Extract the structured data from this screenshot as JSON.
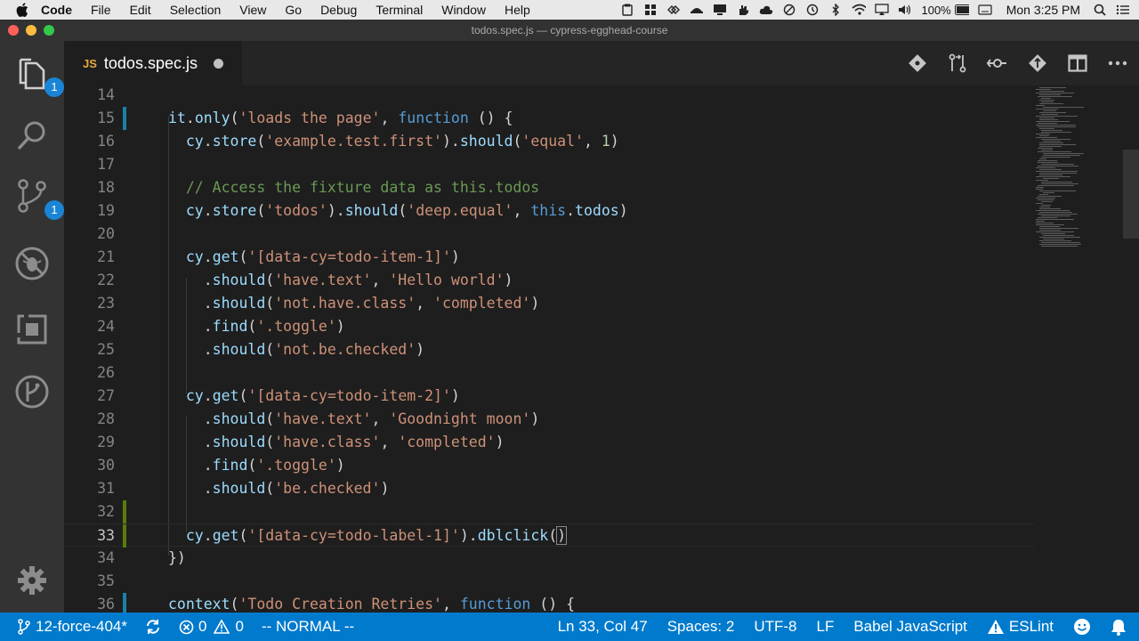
{
  "menubar": {
    "app_name": "Code",
    "items": [
      "File",
      "Edit",
      "Selection",
      "View",
      "Go",
      "Debug",
      "Terminal",
      "Window",
      "Help"
    ],
    "battery": "100%",
    "clock": "Mon 3:25 PM"
  },
  "window": {
    "title": "todos.spec.js — cypress-egghead-course"
  },
  "activity": {
    "explorer_badge": "1",
    "scm_badge": "1"
  },
  "tab": {
    "badge": "JS",
    "label": "todos.spec.js"
  },
  "editor": {
    "lines": [
      {
        "n": "14",
        "tokens": []
      },
      {
        "n": "15",
        "tokens": [
          [
            "var",
            "it"
          ],
          [
            "plain",
            "."
          ],
          [
            "var",
            "only"
          ],
          [
            "plain",
            "("
          ],
          [
            "str",
            "'loads the page'"
          ],
          [
            "plain",
            ", "
          ],
          [
            "kw",
            "function"
          ],
          [
            "plain",
            " () {"
          ]
        ]
      },
      {
        "n": "16",
        "tokens": [
          [
            "plain",
            "  "
          ],
          [
            "var",
            "cy"
          ],
          [
            "plain",
            "."
          ],
          [
            "var",
            "store"
          ],
          [
            "plain",
            "("
          ],
          [
            "str",
            "'example.test.first'"
          ],
          [
            "plain",
            ")."
          ],
          [
            "var",
            "should"
          ],
          [
            "plain",
            "("
          ],
          [
            "str",
            "'equal'"
          ],
          [
            "plain",
            ", "
          ],
          [
            "num",
            "1"
          ],
          [
            "plain",
            ")"
          ]
        ]
      },
      {
        "n": "17",
        "tokens": []
      },
      {
        "n": "18",
        "tokens": [
          [
            "plain",
            "  "
          ],
          [
            "com",
            "// Access the fixture data as this.todos"
          ]
        ]
      },
      {
        "n": "19",
        "tokens": [
          [
            "plain",
            "  "
          ],
          [
            "var",
            "cy"
          ],
          [
            "plain",
            "."
          ],
          [
            "var",
            "store"
          ],
          [
            "plain",
            "("
          ],
          [
            "str",
            "'todos'"
          ],
          [
            "plain",
            ")."
          ],
          [
            "var",
            "should"
          ],
          [
            "plain",
            "("
          ],
          [
            "str",
            "'deep.equal'"
          ],
          [
            "plain",
            ", "
          ],
          [
            "kw",
            "this"
          ],
          [
            "plain",
            "."
          ],
          [
            "var",
            "todos"
          ],
          [
            "plain",
            ")"
          ]
        ]
      },
      {
        "n": "20",
        "tokens": []
      },
      {
        "n": "21",
        "tokens": [
          [
            "plain",
            "  "
          ],
          [
            "var",
            "cy"
          ],
          [
            "plain",
            "."
          ],
          [
            "var",
            "get"
          ],
          [
            "plain",
            "("
          ],
          [
            "str",
            "'[data-cy=todo-item-1]'"
          ],
          [
            "plain",
            ")"
          ]
        ]
      },
      {
        "n": "22",
        "tokens": [
          [
            "plain",
            "    ."
          ],
          [
            "var",
            "should"
          ],
          [
            "plain",
            "("
          ],
          [
            "str",
            "'have.text'"
          ],
          [
            "plain",
            ", "
          ],
          [
            "str",
            "'Hello world'"
          ],
          [
            "plain",
            ")"
          ]
        ]
      },
      {
        "n": "23",
        "tokens": [
          [
            "plain",
            "    ."
          ],
          [
            "var",
            "should"
          ],
          [
            "plain",
            "("
          ],
          [
            "str",
            "'not.have.class'"
          ],
          [
            "plain",
            ", "
          ],
          [
            "str",
            "'completed'"
          ],
          [
            "plain",
            ")"
          ]
        ]
      },
      {
        "n": "24",
        "tokens": [
          [
            "plain",
            "    ."
          ],
          [
            "var",
            "find"
          ],
          [
            "plain",
            "("
          ],
          [
            "str",
            "'.toggle'"
          ],
          [
            "plain",
            ")"
          ]
        ]
      },
      {
        "n": "25",
        "tokens": [
          [
            "plain",
            "    ."
          ],
          [
            "var",
            "should"
          ],
          [
            "plain",
            "("
          ],
          [
            "str",
            "'not.be.checked'"
          ],
          [
            "plain",
            ")"
          ]
        ]
      },
      {
        "n": "26",
        "tokens": []
      },
      {
        "n": "27",
        "tokens": [
          [
            "plain",
            "  "
          ],
          [
            "var",
            "cy"
          ],
          [
            "plain",
            "."
          ],
          [
            "var",
            "get"
          ],
          [
            "plain",
            "("
          ],
          [
            "str",
            "'[data-cy=todo-item-2]'"
          ],
          [
            "plain",
            ")"
          ]
        ]
      },
      {
        "n": "28",
        "tokens": [
          [
            "plain",
            "    ."
          ],
          [
            "var",
            "should"
          ],
          [
            "plain",
            "("
          ],
          [
            "str",
            "'have.text'"
          ],
          [
            "plain",
            ", "
          ],
          [
            "str",
            "'Goodnight moon'"
          ],
          [
            "plain",
            ")"
          ]
        ]
      },
      {
        "n": "29",
        "tokens": [
          [
            "plain",
            "    ."
          ],
          [
            "var",
            "should"
          ],
          [
            "plain",
            "("
          ],
          [
            "str",
            "'have.class'"
          ],
          [
            "plain",
            ", "
          ],
          [
            "str",
            "'completed'"
          ],
          [
            "plain",
            ")"
          ]
        ]
      },
      {
        "n": "30",
        "tokens": [
          [
            "plain",
            "    ."
          ],
          [
            "var",
            "find"
          ],
          [
            "plain",
            "("
          ],
          [
            "str",
            "'.toggle'"
          ],
          [
            "plain",
            ")"
          ]
        ]
      },
      {
        "n": "31",
        "tokens": [
          [
            "plain",
            "    ."
          ],
          [
            "var",
            "should"
          ],
          [
            "plain",
            "("
          ],
          [
            "str",
            "'be.checked'"
          ],
          [
            "plain",
            ")"
          ]
        ]
      },
      {
        "n": "32",
        "tokens": []
      },
      {
        "n": "33",
        "tokens": [
          [
            "plain",
            "  "
          ],
          [
            "var",
            "cy"
          ],
          [
            "plain",
            "."
          ],
          [
            "var",
            "get"
          ],
          [
            "plain",
            "("
          ],
          [
            "str",
            "'[data-cy=todo-label-1]'"
          ],
          [
            "plain",
            ")."
          ],
          [
            "var",
            "dblclick"
          ],
          [
            "plain",
            "("
          ],
          [
            "cursor",
            ")"
          ]
        ]
      },
      {
        "n": "34",
        "tokens": [
          [
            "plain",
            "})"
          ]
        ]
      },
      {
        "n": "35",
        "tokens": []
      },
      {
        "n": "36",
        "tokens": [
          [
            "var",
            "context"
          ],
          [
            "plain",
            "("
          ],
          [
            "str",
            "'Todo Creation Retries'"
          ],
          [
            "plain",
            ", "
          ],
          [
            "kw",
            "function"
          ],
          [
            "plain",
            " () {"
          ]
        ]
      }
    ]
  },
  "statusbar": {
    "branch": "12-force-404*",
    "errors": "0",
    "warnings": "0",
    "mode": "-- NORMAL --",
    "position": "Ln 33, Col 47",
    "spaces": "Spaces: 2",
    "encoding": "UTF-8",
    "eol": "LF",
    "language": "Babel JavaScript",
    "linter": "ESLint"
  }
}
